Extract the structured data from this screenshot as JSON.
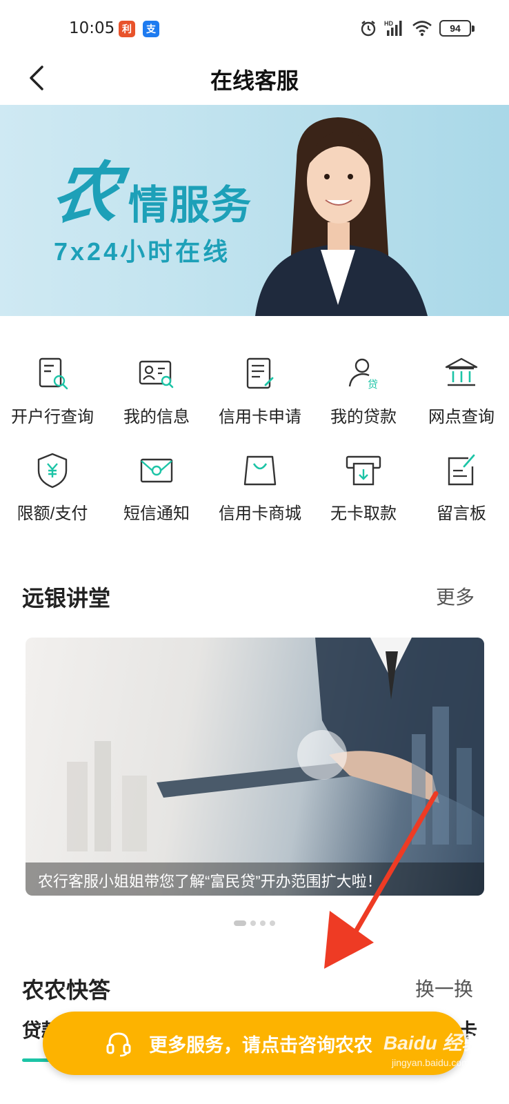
{
  "status_bar": {
    "time": "10:05",
    "badge_1": "利",
    "badge_2": "支",
    "signal_label": "HD",
    "battery": "94"
  },
  "header": {
    "title": "在线客服"
  },
  "banner": {
    "logo_char": "农",
    "title": "情服务",
    "subtitle": "7x24小时在线"
  },
  "services": [
    {
      "label": "开户行查询",
      "icon": "document-search-icon"
    },
    {
      "label": "我的信息",
      "icon": "id-card-search-icon"
    },
    {
      "label": "信用卡申请",
      "icon": "document-edit-icon"
    },
    {
      "label": "我的贷款",
      "icon": "user-loan-icon"
    },
    {
      "label": "网点查询",
      "icon": "bank-building-icon"
    },
    {
      "label": "限额/支付",
      "icon": "shield-yuan-icon"
    },
    {
      "label": "短信通知",
      "icon": "envelope-icon"
    },
    {
      "label": "信用卡商城",
      "icon": "shopping-bag-icon"
    },
    {
      "label": "无卡取款",
      "icon": "atm-withdraw-icon"
    },
    {
      "label": "留言板",
      "icon": "note-edit-icon"
    }
  ],
  "lecture": {
    "title": "远银讲堂",
    "more": "更多",
    "caption": "农行客服小姐姐带您了解“富民贷”开办范围扩大啦！",
    "slide_count": 4,
    "active_slide": 1
  },
  "faq": {
    "title": "农农快答",
    "refresh": "换一换",
    "tab_left": "贷款",
    "tab_right": "卡"
  },
  "float_button": {
    "label": "更多服务，请点击咨询农农"
  },
  "watermark": {
    "text": "Baidu 经验",
    "sub": "jingyan.baidu.com"
  },
  "colors": {
    "accent": "#1cc4a6",
    "float_button": "#fdb300",
    "banner_text": "#1da0b8",
    "annotation_arrow": "#ee3b24"
  }
}
